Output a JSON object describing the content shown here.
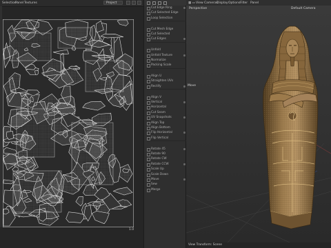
{
  "uv_editor": {
    "menu": [
      "Selection",
      "Panel",
      "Textures"
    ],
    "project_select": "Project",
    "scale_label": "1.0"
  },
  "side_panel": {
    "rows": [
      "Cut Edge Ring",
      "Cut Selected Edge",
      "Loop Selection",
      "",
      "Cut Mesh Edge",
      "Cut Selected",
      "Cut Edges",
      "",
      "Unfold",
      "Unfold Texture",
      "Normalize",
      "Packing Scale",
      "",
      "Align U",
      "Straighten UVs",
      "Rectify",
      "",
      "Align V",
      "Vertical",
      "Horizontal",
      "Cut Seam",
      "UV Snapshots",
      "Align Top",
      "Align Bottom",
      "Flip Horizontal",
      "Flip Vertical",
      "",
      "Rotate 45",
      "Rotate 90",
      "Rotate CW",
      "Rotate CCW",
      "Scale Up",
      "Scale Down",
      "Move",
      "Sew",
      "Merge"
    ]
  },
  "viewport": {
    "menu": [
      "View",
      "Cameras",
      "Display",
      "Options",
      "Filter",
      "Panel"
    ],
    "label_perspective": "Perspective",
    "label_camera": "Default Camera",
    "label_move": "Move",
    "status": "View Transform: Scene"
  },
  "colors": {
    "uv_wire": "#c9c9c9",
    "uv_bg": "#262626",
    "statue_base": "#9b7a4c",
    "statue_dark": "#5c4526",
    "statue_light": "#c9a86f"
  }
}
